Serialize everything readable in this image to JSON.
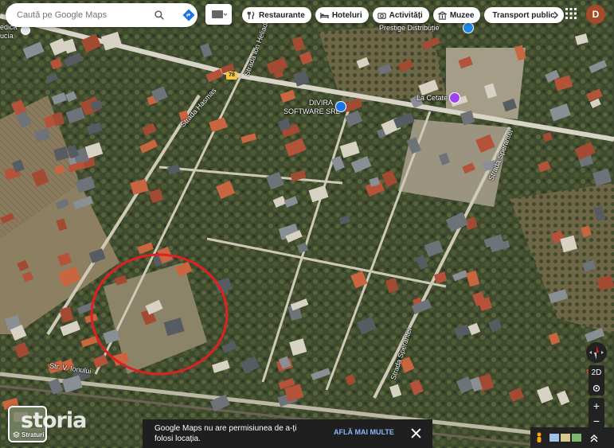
{
  "search": {
    "placeholder": "Caută pe Google Maps"
  },
  "chips": [
    {
      "label": "Restaurante",
      "icon": "fork-knife-icon"
    },
    {
      "label": "Hoteluri",
      "icon": "bed-icon"
    },
    {
      "label": "Activități",
      "icon": "camera-icon"
    },
    {
      "label": "Muzee",
      "icon": "museum-icon"
    },
    {
      "label": "Transport public",
      "icon": "bus-icon"
    }
  ],
  "account": {
    "initial": "D"
  },
  "map": {
    "streets": {
      "street_1": "Strada Hasmas",
      "street_2": "Strada Ion Heliade",
      "street_3": "Strada Sperantei",
      "street_4": "Str. V. Ionului",
      "street_5": "Strada Sperantei"
    },
    "route_shield": "78",
    "pois": {
      "prestige": "Prestige Distribuție",
      "divira": "DIVIRA",
      "divira_sub": "SOFTWARE SRL",
      "cetate": "La Cetate",
      "medical": "edica",
      "medical_sub": "ucia"
    }
  },
  "layer_toggle": {
    "label": "Straturi"
  },
  "watermark": "storia",
  "notice": {
    "message": "Google Maps nu are permisiunea de a-ți folosi locația.",
    "action": "AFLĂ MAI MULTE"
  },
  "controls": {
    "view_mode": "2D",
    "zoom_in": "+",
    "zoom_out": "−"
  },
  "colors": {
    "accent_blue": "#1a73e8",
    "marker_red": "#e02020",
    "notice_bg": "#1f1f1f"
  }
}
